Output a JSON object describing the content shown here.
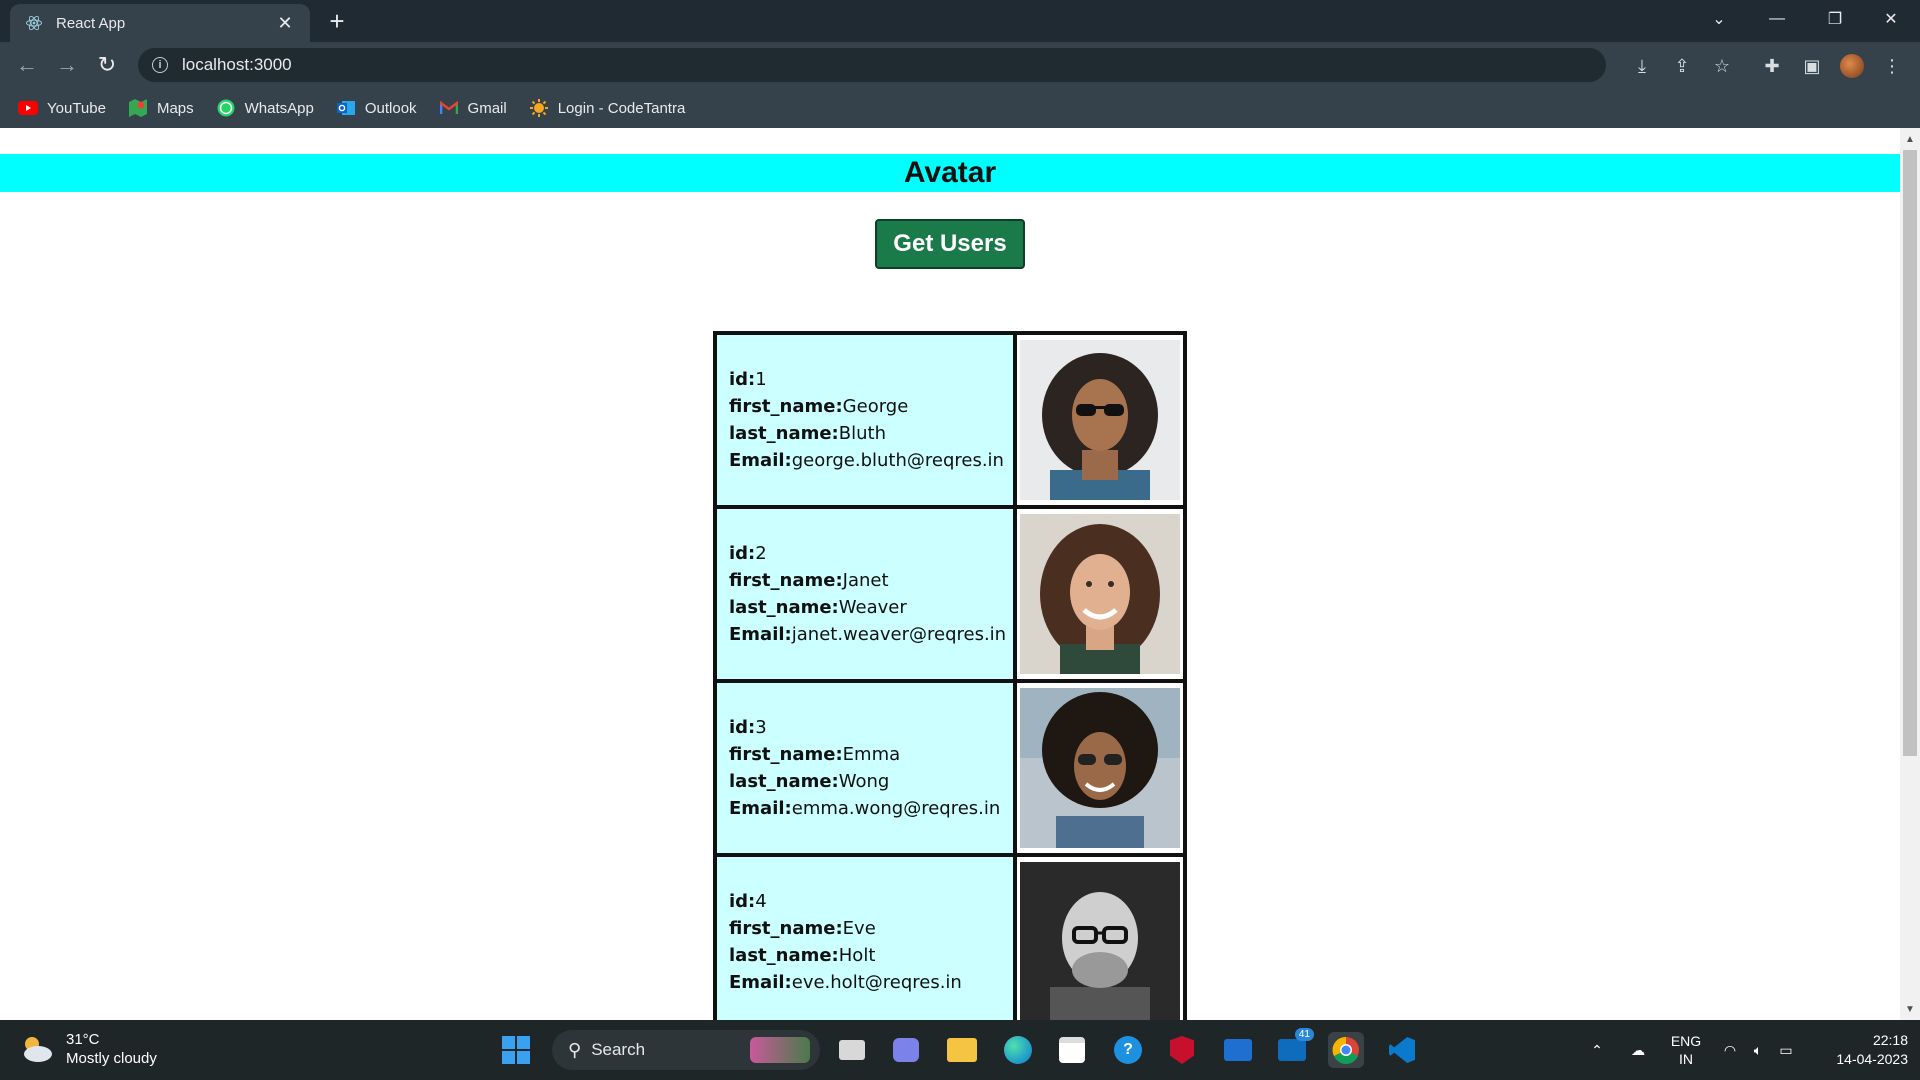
{
  "browser": {
    "tab_title": "React App",
    "url": "localhost:3000",
    "bookmarks": [
      {
        "label": "YouTube",
        "icon": "youtube-icon",
        "color": "#ff0000"
      },
      {
        "label": "Maps",
        "icon": "maps-icon",
        "color": "#34a853"
      },
      {
        "label": "WhatsApp",
        "icon": "whatsapp-icon",
        "color": "#25d366"
      },
      {
        "label": "Outlook",
        "icon": "outlook-icon",
        "color": "#0a64c8"
      },
      {
        "label": "Gmail",
        "icon": "gmail-icon",
        "color": "#ea4335"
      },
      {
        "label": "Login - CodeTantra",
        "icon": "codetantra-icon",
        "color": "#f5a623"
      }
    ]
  },
  "page": {
    "heading": "Avatar",
    "get_users_label": "Get Users",
    "labels": {
      "id": "id:",
      "first_name": "first_name:",
      "last_name": "last_name:",
      "email": "Email:"
    },
    "users": [
      {
        "id": "1",
        "first_name": "George",
        "last_name": "Bluth",
        "email": "george.bluth@reqres.in"
      },
      {
        "id": "2",
        "first_name": "Janet",
        "last_name": "Weaver",
        "email": "janet.weaver@reqres.in"
      },
      {
        "id": "3",
        "first_name": "Emma",
        "last_name": "Wong",
        "email": "emma.wong@reqres.in"
      },
      {
        "id": "4",
        "first_name": "Eve",
        "last_name": "Holt",
        "email": "eve.holt@reqres.in"
      }
    ],
    "colors": {
      "header_bg": "#00ffff",
      "button_bg": "#1b7a4a",
      "cell_bg": "#ccffff"
    }
  },
  "taskbar": {
    "weather_temp": "31°C",
    "weather_desc": "Mostly cloudy",
    "search_label": "Search",
    "language": "ENG",
    "region": "IN",
    "time": "22:18",
    "date": "14-04-2023",
    "mail_badge": "41"
  }
}
